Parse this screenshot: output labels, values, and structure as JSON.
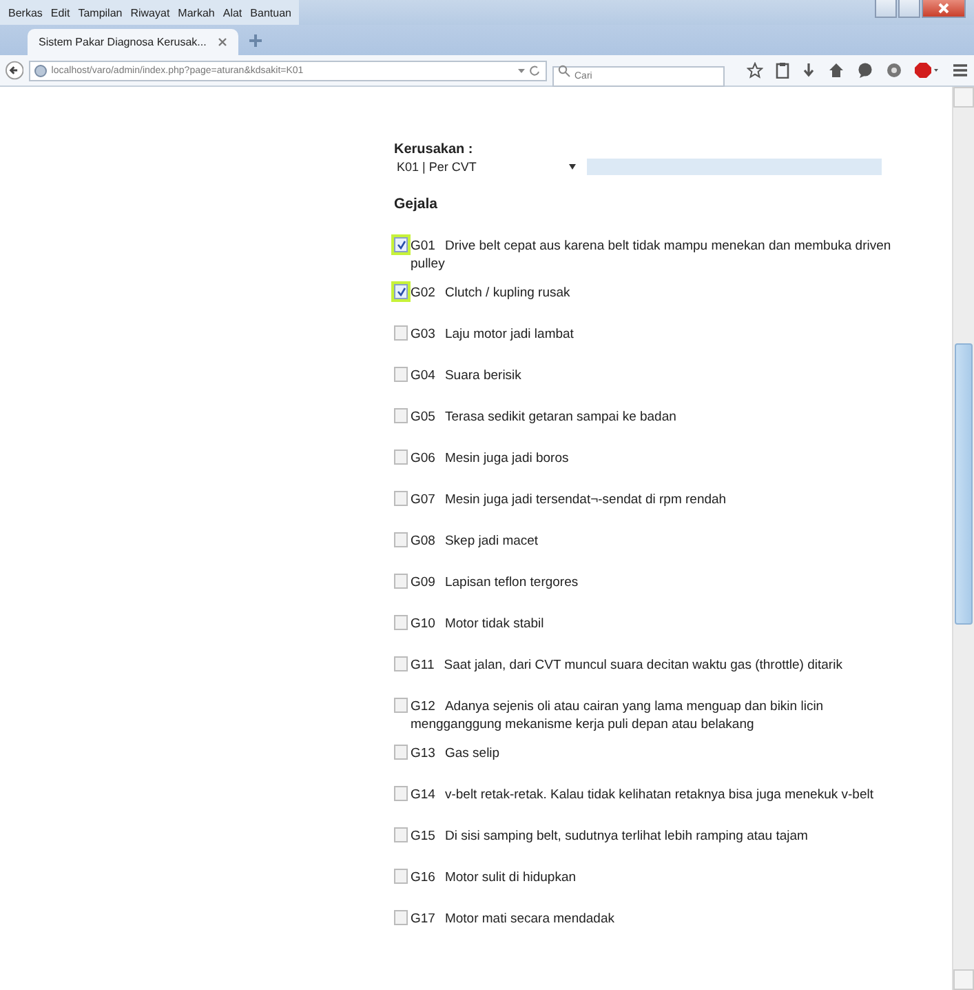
{
  "menu": [
    "Berkas",
    "Edit",
    "Tampilan",
    "Riwayat",
    "Markah",
    "Alat",
    "Bantuan"
  ],
  "tabs": [
    {
      "label": "Sistem Pakar Diagnosa Kerusak...",
      "selected": true
    }
  ],
  "address": "localhost/varo/admin/index.php?page=aturan&kdsakit=K01",
  "search": {
    "placeholder": "Cari"
  },
  "form": {
    "kerusakan_label": "Kerusakan :",
    "kerusakan_value": "K01 | Per CVT",
    "gejala_heading": "Gejala"
  },
  "gejala": [
    {
      "code": "G01",
      "text": "Drive belt cepat aus karena belt tidak mampu menekan dan membuka driven pulley",
      "checked": true
    },
    {
      "code": "G02",
      "text": "Clutch / kupling rusak",
      "checked": true
    },
    {
      "code": "G03",
      "text": "Laju motor jadi lambat",
      "checked": false
    },
    {
      "code": "G04",
      "text": "Suara berisik",
      "checked": false
    },
    {
      "code": "G05",
      "text": "Terasa sedikit getaran sampai ke badan",
      "checked": false
    },
    {
      "code": "G06",
      "text": "Mesin juga jadi boros",
      "checked": false
    },
    {
      "code": "G07",
      "text": "Mesin juga jadi tersendat¬-sendat di rpm rendah",
      "checked": false
    },
    {
      "code": "G08",
      "text": "Skep jadi macet",
      "checked": false
    },
    {
      "code": "G09",
      "text": "Lapisan teflon tergores",
      "checked": false
    },
    {
      "code": "G10",
      "text": "Motor tidak stabil",
      "checked": false
    },
    {
      "code": "G11",
      "text": "Saat jalan, dari CVT muncul suara decitan waktu gas (throttle) ditarik",
      "checked": false
    },
    {
      "code": "G12",
      "text": "Adanya sejenis oli atau cairan yang lama menguap dan bikin licin mengganggung mekanisme kerja puli depan atau belakang",
      "checked": false
    },
    {
      "code": "G13",
      "text": "Gas selip",
      "checked": false
    },
    {
      "code": "G14",
      "text": "v-belt retak-retak. Kalau tidak kelihatan retaknya bisa juga menekuk v-belt",
      "checked": false
    },
    {
      "code": "G15",
      "text": "Di sisi samping belt, sudutnya terlihat lebih ramping atau tajam",
      "checked": false
    },
    {
      "code": "G16",
      "text": "Motor sulit di hidupkan",
      "checked": false
    },
    {
      "code": "G17",
      "text": "Motor mati secara mendadak",
      "checked": false
    }
  ]
}
